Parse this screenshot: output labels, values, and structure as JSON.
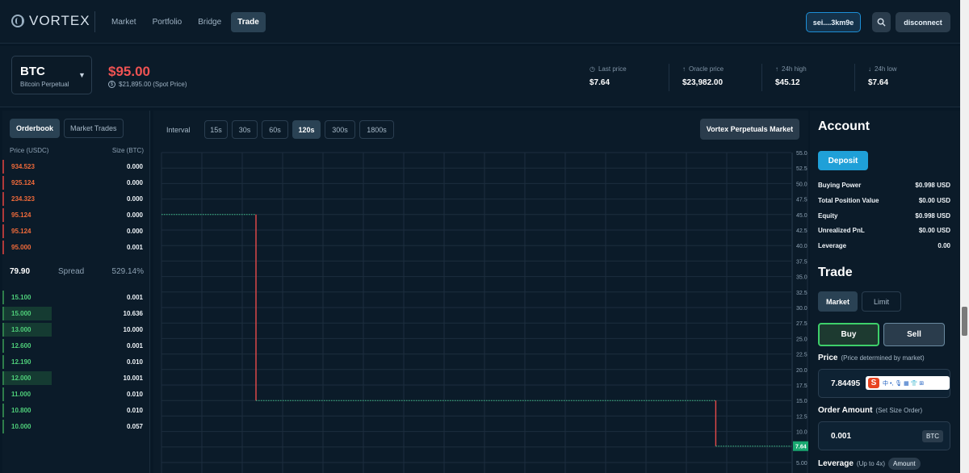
{
  "app": {
    "logo_text": "VORTEX",
    "nav": [
      {
        "label": "Market"
      },
      {
        "label": "Portfolio"
      },
      {
        "label": "Bridge"
      },
      {
        "label": "Trade",
        "active": true
      }
    ],
    "wallet_label": "sei....3km9e",
    "disconnect_label": "disconnect"
  },
  "market": {
    "symbol": "BTC",
    "name": "Bitcoin Perpetual",
    "price": "$95.00",
    "spot_price": "$21,895.00 (Spot Price)",
    "stats": [
      {
        "label": "Last price",
        "value": "$7.64",
        "icon": "clock-icon"
      },
      {
        "label": "Oracle price",
        "value": "$23,982.00",
        "icon": "arrow-up-icon"
      },
      {
        "label": "24h high",
        "value": "$45.12",
        "icon": "arrow-up-icon"
      },
      {
        "label": "24h low",
        "value": "$7.64",
        "icon": "arrow-down-icon"
      }
    ]
  },
  "orderbook": {
    "tabs": [
      "Orderbook",
      "Market Trades"
    ],
    "price_header": "Price (USDC)",
    "size_header": "Size (BTC)",
    "asks": [
      {
        "price": "934.523",
        "size": "0.000"
      },
      {
        "price": "925.124",
        "size": "0.000"
      },
      {
        "price": "234.323",
        "size": "0.000"
      },
      {
        "price": "95.124",
        "size": "0.000"
      },
      {
        "price": "95.124",
        "size": "0.000"
      },
      {
        "price": "95.000",
        "size": "0.001"
      }
    ],
    "spread": {
      "last": "79.90",
      "label": "Spread",
      "pct": "529.14%"
    },
    "bids": [
      {
        "price": "15.100",
        "size": "0.001",
        "depth": 0
      },
      {
        "price": "15.000",
        "size": "10.636",
        "depth": 0.33
      },
      {
        "price": "13.000",
        "size": "10.000",
        "depth": 0.33
      },
      {
        "price": "12.600",
        "size": "0.001",
        "depth": 0
      },
      {
        "price": "12.190",
        "size": "0.010",
        "depth": 0
      },
      {
        "price": "12.000",
        "size": "10.001",
        "depth": 0.33
      },
      {
        "price": "11.000",
        "size": "0.010",
        "depth": 0
      },
      {
        "price": "10.800",
        "size": "0.010",
        "depth": 0
      },
      {
        "price": "10.000",
        "size": "0.057",
        "depth": 0
      }
    ]
  },
  "chart": {
    "interval_label": "Interval",
    "intervals": [
      "15s",
      "30s",
      "60s",
      "120s",
      "300s",
      "1800s"
    ],
    "active_interval": "120s",
    "market_tag": "Vortex Perpetuals Market"
  },
  "chart_data": {
    "type": "line",
    "title": "",
    "xlabel": "",
    "ylabel": "",
    "ylim": [
      5,
      55
    ],
    "yticks": [
      "55.0",
      "52.5",
      "50.0",
      "47.5",
      "45.0",
      "42.5",
      "40.0",
      "37.5",
      "35.0",
      "32.5",
      "30.0",
      "27.5",
      "25.0",
      "22.5",
      "20.0",
      "17.5",
      "15.0",
      "12.5",
      "10.0",
      "7.5",
      "5.00"
    ],
    "series": [
      {
        "points": [
          {
            "x": 0.0,
            "y": 45.0
          },
          {
            "x": 0.15,
            "y": 45.0
          },
          {
            "x": 0.15,
            "y": 15.0
          },
          {
            "x": 0.88,
            "y": 15.0
          },
          {
            "x": 0.88,
            "y": 7.64
          },
          {
            "x": 1.0,
            "y": 7.64
          }
        ]
      }
    ],
    "last_price_label": "7.64",
    "last_price": 7.64,
    "colors": {
      "line": "#3ec08a",
      "drop": "#e84a4a",
      "grid": "#1c2e3e",
      "last": "#18a870"
    }
  },
  "account": {
    "title": "Account",
    "deposit_label": "Deposit",
    "rows": [
      {
        "label": "Buying Power",
        "value": "$0.998 USD"
      },
      {
        "label": "Total Position Value",
        "value": "$0.00 USD"
      },
      {
        "label": "Equity",
        "value": "$0.998 USD"
      },
      {
        "label": "Unrealized PnL",
        "value": "$0.00 USD"
      },
      {
        "label": "Leverage",
        "value": "0.00"
      }
    ]
  },
  "trade": {
    "title": "Trade",
    "order_types": [
      "Market",
      "Limit"
    ],
    "active_type": "Market",
    "buy_label": "Buy",
    "sell_label": "Sell",
    "price_label": "Price",
    "price_hint": "(Price determined by market)",
    "price_value": "7.84495",
    "ime": {
      "logo": "S",
      "text": "中 •, 🎙 ▦ 👕 ⊞"
    },
    "amount_label": "Order Amount",
    "amount_hint": "(Set Size Order)",
    "amount_value": "0.001",
    "amount_unit": "BTC",
    "leverage_label": "Leverage",
    "leverage_hint": "(Up to 4x)",
    "leverage_badge": "Amount"
  }
}
